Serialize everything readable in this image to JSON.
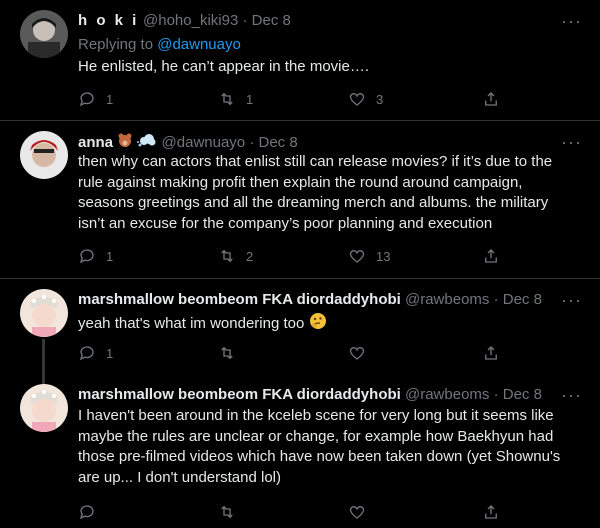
{
  "tweets": [
    {
      "name": "h o k i",
      "handle": "@hoho_kiki93",
      "date": "Dec 8",
      "replying_label": "Replying to",
      "replying_to": "@dawnuayo",
      "text": "He enlisted, he can’t appear in the movie….",
      "replies": "1",
      "retweets": "1",
      "likes": "3"
    },
    {
      "name": "anna",
      "handle": "@dawnuayo",
      "date": "Dec 8",
      "name_emoji": [
        "bear-emoji",
        "cloud-emoji"
      ],
      "text": "then why can actors that enlist still can release movies? if it’s due to the rule against making profit then explain the round around campaign, seasons greetings and all the dreaming merch and albums. the military isn’t an excuse for the company’s poor planning and execution",
      "replies": "1",
      "retweets": "2",
      "likes": "13"
    },
    {
      "name": "marshmallow beombeom FKA diordaddyhobi",
      "handle": "@rawbeoms",
      "date": "Dec 8",
      "text": "yeah that's what im wondering too",
      "text_emoji": "thinking-face-emoji",
      "replies": "1",
      "retweets": "",
      "likes": ""
    },
    {
      "name": "marshmallow beombeom FKA diordaddyhobi",
      "handle": "@rawbeoms",
      "date": "Dec 8",
      "text": "I haven't been around in the kceleb scene for very long but it seems like maybe the rules are unclear or change, for example how Baekhyun had those pre-filmed videos which have now been taken down (yet Shownu's are up... I don't understand lol)",
      "replies": "",
      "retweets": "",
      "likes": ""
    }
  ],
  "separator": "·",
  "colors": {
    "background": "#000000",
    "text": "#e7e9ea",
    "muted": "#71767b",
    "link": "#1d9bf0",
    "divider": "#2f3336"
  },
  "icons": [
    "reply-icon",
    "retweet-icon",
    "like-icon",
    "share-icon",
    "more-icon"
  ]
}
